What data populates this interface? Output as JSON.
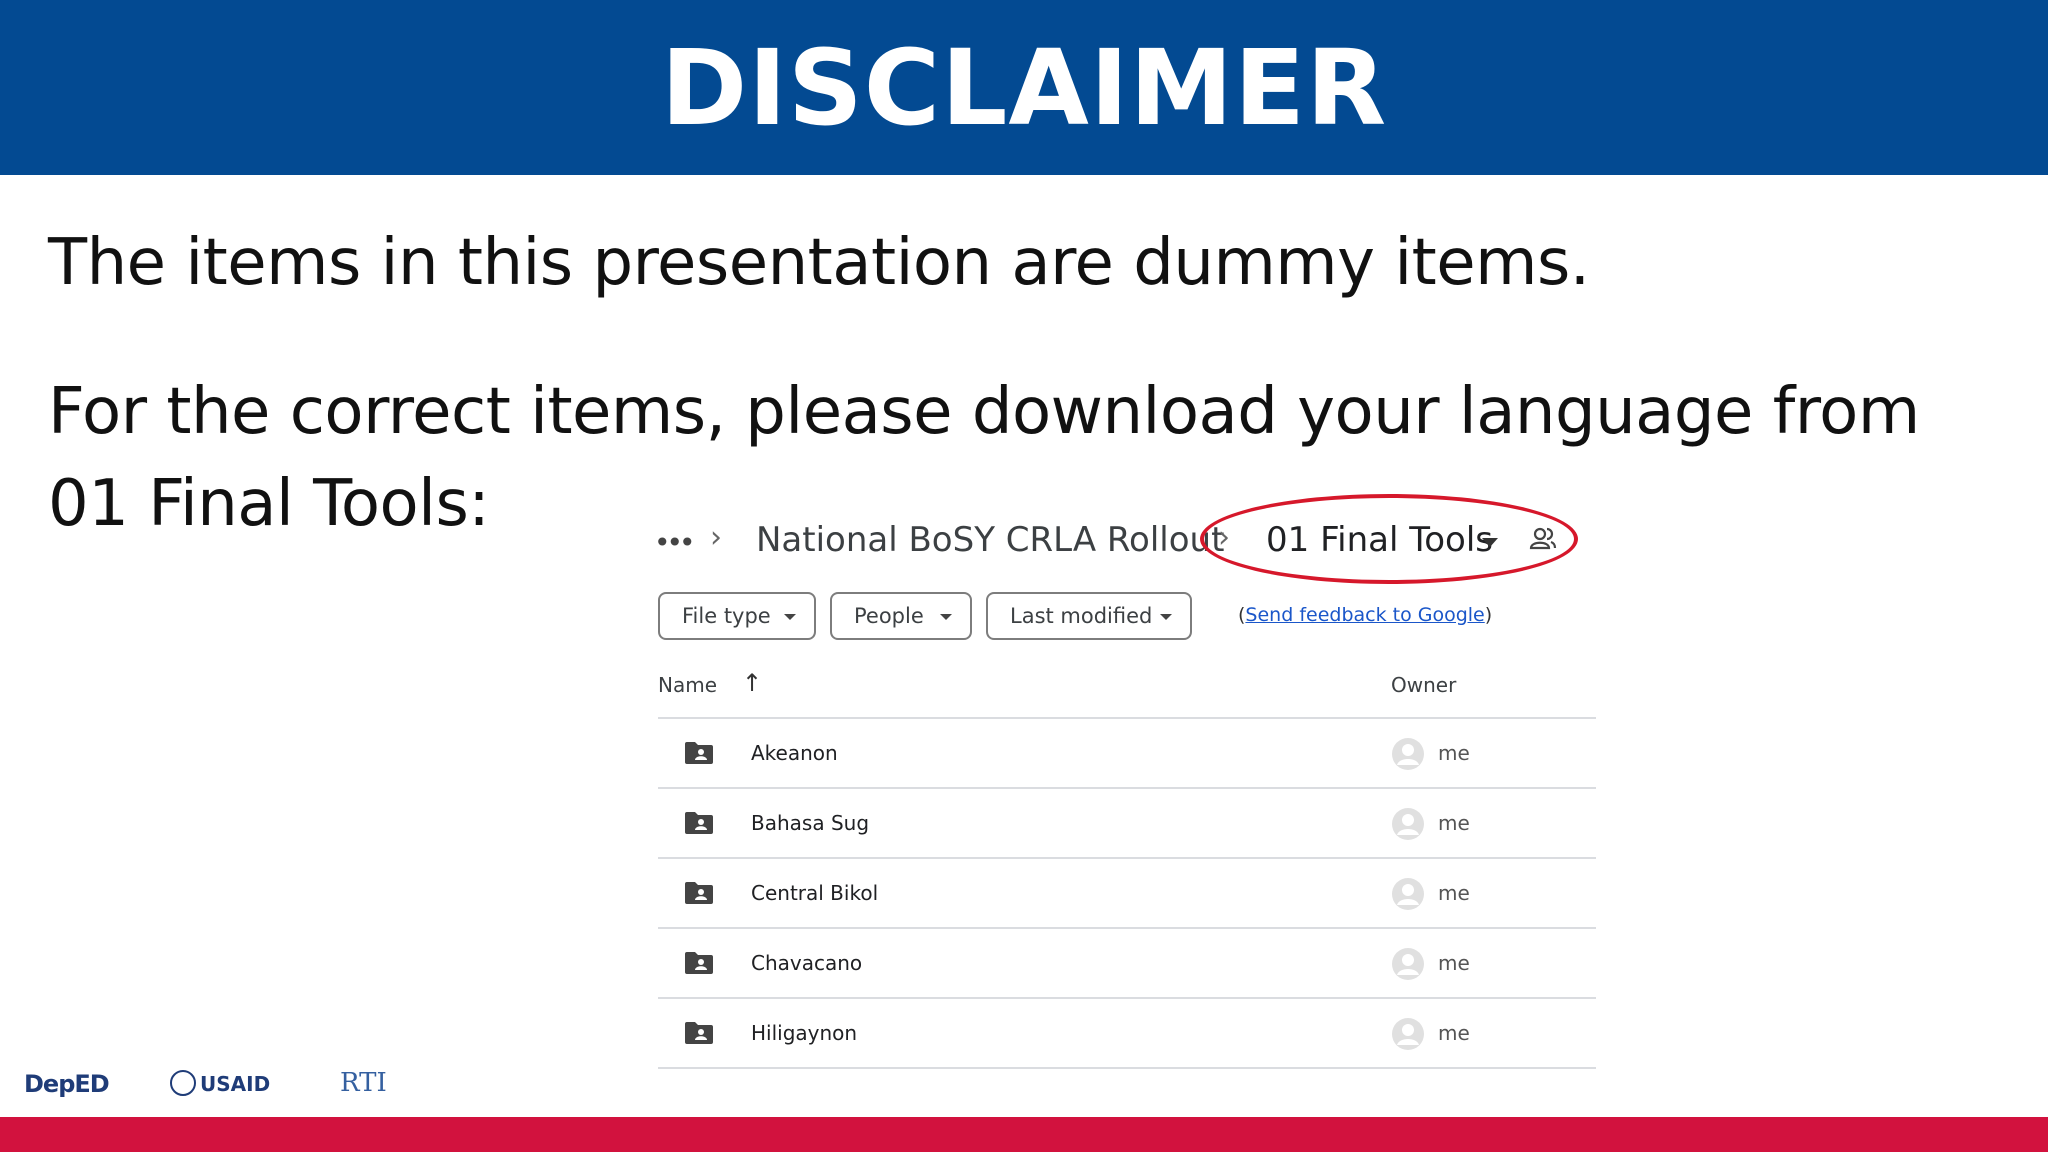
{
  "slide": {
    "title": "DISCLAIMER",
    "line1": "The items in this presentation are dummy items.",
    "line2": "For the correct items, please download your language from 01 Final Tools:"
  },
  "drive": {
    "breadcrumb": {
      "more_icon": "more-horiz-icon",
      "parent": "National BoSY CRLA Rollout",
      "current": "01 Final Tools",
      "shared_icon": "people-icon",
      "highlight_color": "#d6182b"
    },
    "filters": {
      "file_type": "File type",
      "people": "People",
      "last_modified": "Last modified",
      "feedback_open": "(",
      "feedback_link": "Send feedback to Google",
      "feedback_close": ")"
    },
    "columns": {
      "name": "Name",
      "sort_icon": "arrow-up-icon",
      "owner": "Owner"
    },
    "rows": [
      {
        "name": "Akeanon",
        "owner": "me"
      },
      {
        "name": "Bahasa Sug",
        "owner": "me"
      },
      {
        "name": "Central Bikol",
        "owner": "me"
      },
      {
        "name": "Chavacano",
        "owner": "me"
      },
      {
        "name": "Hiligaynon",
        "owner": "me"
      }
    ]
  },
  "footer": {
    "logo_deped": "DepED",
    "logo_usaid": "USAID",
    "logo_rti": "RTI"
  },
  "colors": {
    "title_bar": "#034a92",
    "bottom_bar": "#d2123e",
    "link": "#1a56c9"
  }
}
